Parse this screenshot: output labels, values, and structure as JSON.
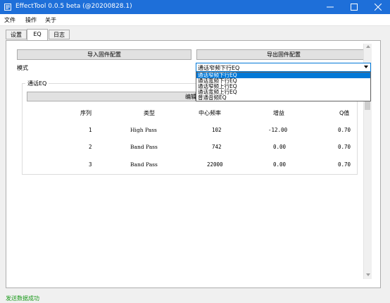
{
  "window": {
    "title": "EffectTool 0.0.5 beta  (@20200828.1)",
    "titlebar_color": "#1e6fd9"
  },
  "menu": {
    "items": [
      "文件",
      "操作",
      "关于"
    ]
  },
  "tabs": [
    {
      "label": "设置",
      "active": false
    },
    {
      "label": "EQ",
      "active": true
    },
    {
      "label": "日志",
      "active": false
    }
  ],
  "eq": {
    "import_button": "导入固件配置",
    "export_button": "导出固件配置",
    "mode_label": "模式",
    "mode_selected": "通话窄频下行EQ",
    "mode_options": [
      "通话窄频下行EQ",
      "通话宽频下行EQ",
      "通话窄频上行EQ",
      "通话宽频上行EQ",
      "普通音频EQ"
    ],
    "group_title": "通话EQ",
    "edit_button": "编辑",
    "columns": [
      "序列",
      "类型",
      "中心频率",
      "增益",
      "Q值"
    ],
    "rows": [
      [
        "1",
        "High Pass",
        "102",
        "-12.00",
        "0.70"
      ],
      [
        "2",
        "Band Pass",
        "742",
        "0.00",
        "0.70"
      ],
      [
        "3",
        "Band Pass",
        "22000",
        "0.00",
        "0.70"
      ]
    ]
  },
  "status": {
    "text": "发送数据成功",
    "color": "#1a9a1a"
  },
  "icons": {
    "app": "app-icon",
    "minimize": "minimize-icon",
    "maximize": "maximize-icon",
    "close": "close-icon",
    "dropdown": "chevron-down-icon"
  }
}
